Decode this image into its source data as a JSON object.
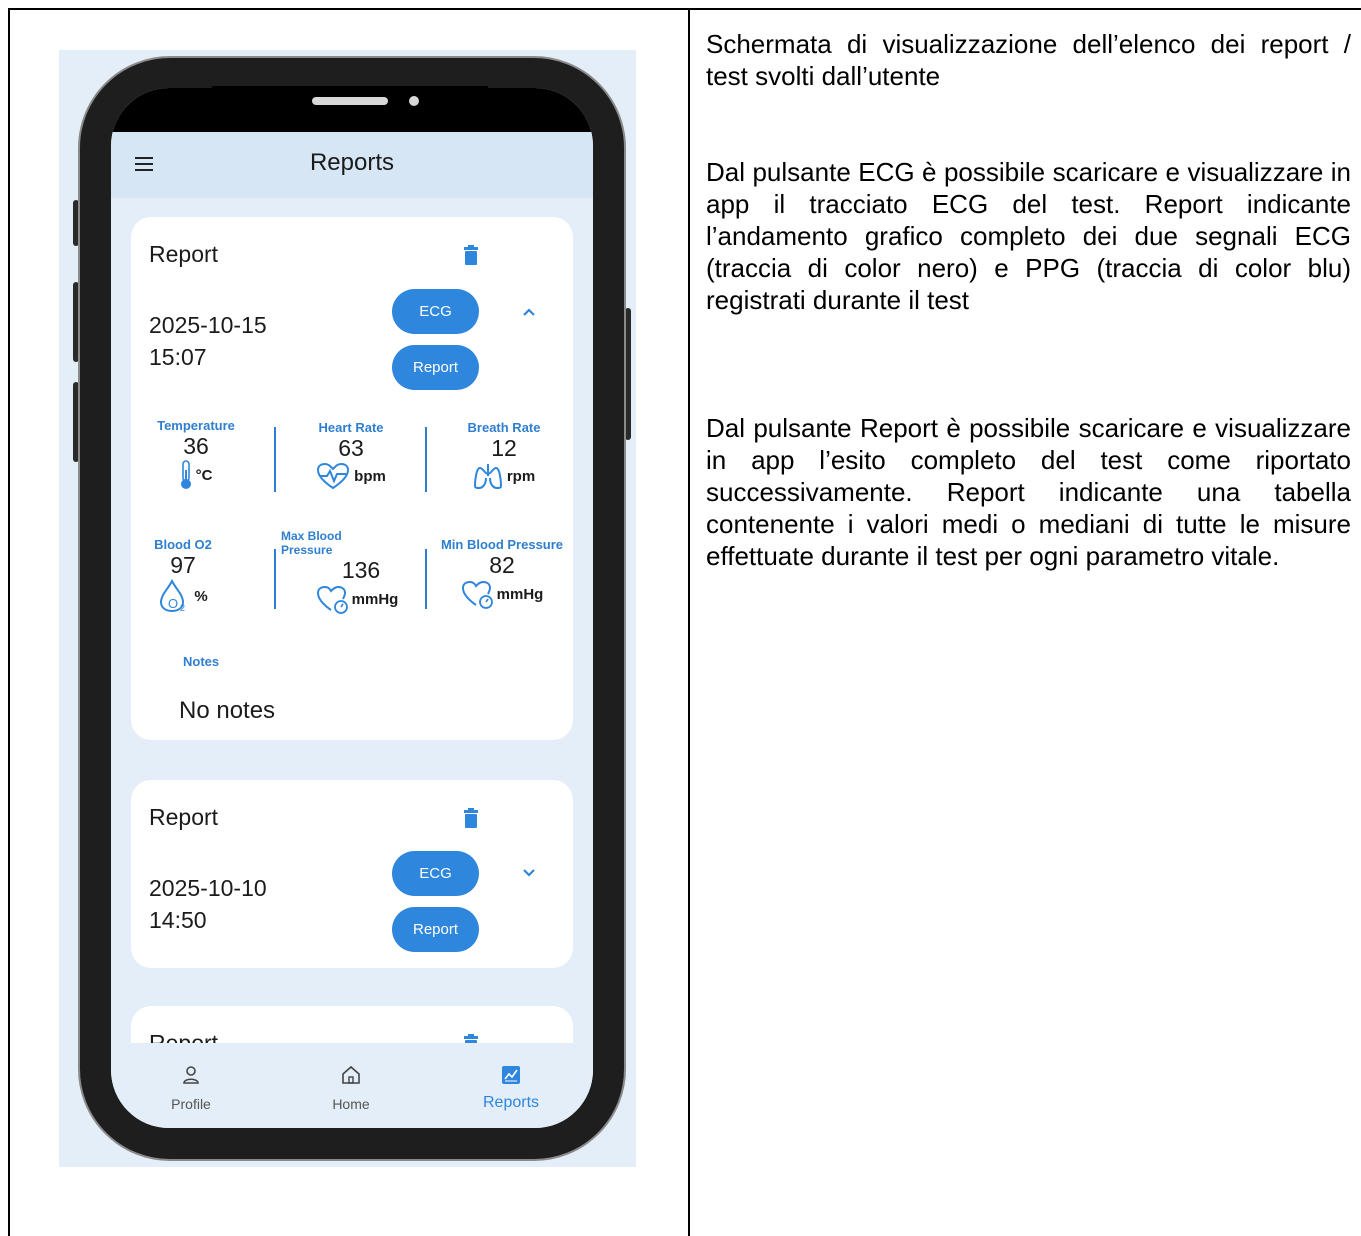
{
  "app": {
    "title": "Reports",
    "reports": [
      {
        "title": "Report",
        "date": "2025-10-15",
        "time": "15:07",
        "ecg_label": "ECG",
        "report_label": "Report",
        "expanded": true,
        "metrics": {
          "temperature": {
            "label": "Temperature",
            "value": "36",
            "unit": "°C"
          },
          "heart_rate": {
            "label": "Heart Rate",
            "value": "63",
            "unit": "bpm"
          },
          "breath_rate": {
            "label": "Breath Rate",
            "value": "12",
            "unit": "rpm"
          },
          "blood_o2": {
            "label": "Blood O2",
            "value": "97",
            "unit": "%"
          },
          "max_bp": {
            "label": "Max Blood Pressure",
            "value": "136",
            "unit": "mmHg"
          },
          "min_bp": {
            "label": "Min Blood Pressure",
            "value": "82",
            "unit": "mmHg"
          }
        },
        "notes_label": "Notes",
        "notes": "No notes"
      },
      {
        "title": "Report",
        "date": "2025-10-10",
        "time": "14:50",
        "ecg_label": "ECG",
        "report_label": "Report",
        "expanded": false
      },
      {
        "title": "Report"
      }
    ],
    "nav": [
      {
        "label": "Profile",
        "icon": "person-icon"
      },
      {
        "label": "Home",
        "icon": "home-icon"
      },
      {
        "label": "Reports",
        "icon": "chart-icon",
        "active": true
      }
    ],
    "colors": {
      "accent": "#2f86dd",
      "background": "#e3eef8",
      "label": "#2f7fd0"
    }
  },
  "description": {
    "p1": "Schermata di visualizzazione dell’elenco dei report / test svolti dall’utente",
    "p2": "Dal pulsante ECG è possibile scaricare e visualizzare in app il tracciato ECG del test. Report indicante l’andamento grafico completo dei due segnali ECG (traccia di color nero) e PPG (traccia di color blu) registrati durante il test",
    "p3": "Dal pulsante Report è possibile scaricare e visualizzare in app l’esito completo del test come riportato successivamente. Report indicante una tabella contenente i valori medi o mediani di tutte le misure effettuate durante il test per ogni parametro vitale."
  }
}
